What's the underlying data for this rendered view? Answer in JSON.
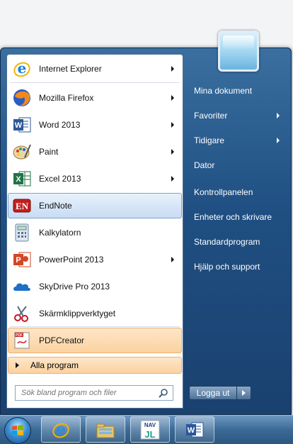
{
  "programs": [
    {
      "label": "Internet Explorer",
      "arrow": true,
      "icon": "internet-explorer-icon",
      "state": "normal"
    },
    {
      "label": "Mozilla Firefox",
      "arrow": true,
      "icon": "firefox-icon",
      "state": "normal"
    },
    {
      "label": "Word 2013",
      "arrow": true,
      "icon": "word-icon",
      "state": "normal"
    },
    {
      "label": "Paint",
      "arrow": true,
      "icon": "paint-icon",
      "state": "normal"
    },
    {
      "label": "Excel 2013",
      "arrow": true,
      "icon": "excel-icon",
      "state": "normal"
    },
    {
      "label": "EndNote",
      "arrow": false,
      "icon": "endnote-icon",
      "state": "hover"
    },
    {
      "label": "Kalkylatorn",
      "arrow": false,
      "icon": "calculator-icon",
      "state": "normal"
    },
    {
      "label": "PowerPoint 2013",
      "arrow": true,
      "icon": "powerpoint-icon",
      "state": "normal"
    },
    {
      "label": "SkyDrive Pro 2013",
      "arrow": false,
      "icon": "skydrive-icon",
      "state": "normal"
    },
    {
      "label": "Skärmklippverktyget",
      "arrow": false,
      "icon": "snipping-tool-icon",
      "state": "normal"
    },
    {
      "label": "PDFCreator",
      "arrow": false,
      "icon": "pdfcreator-icon",
      "state": "new"
    }
  ],
  "all_programs_label": "Alla program",
  "search": {
    "placeholder": "Sök bland program och filer"
  },
  "right_items": [
    {
      "label": "Mina dokument",
      "arrow": false
    },
    {
      "label": "Favoriter",
      "arrow": true
    },
    {
      "label": "Tidigare",
      "arrow": true
    },
    {
      "label": "Dator",
      "arrow": false
    },
    {
      "label": "Kontrollpanelen",
      "arrow": false
    },
    {
      "label": "Enheter och skrivare",
      "arrow": false
    },
    {
      "label": "Standardprogram",
      "arrow": false
    },
    {
      "label": "Hjälp och support",
      "arrow": false
    }
  ],
  "logoff_label": "Logga ut",
  "taskbar": {
    "pinned": [
      "internet-explorer-icon",
      "file-explorer-icon",
      "nav-jl-icon",
      "word-icon"
    ]
  },
  "colors": {
    "accent": "#3a6fa0",
    "highlight_new": "#fbd2a0",
    "highlight_hover": "#c8dcf3"
  }
}
